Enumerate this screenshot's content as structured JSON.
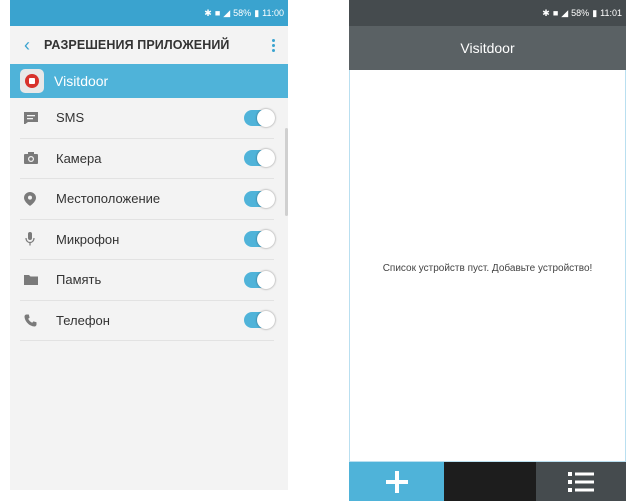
{
  "left_screen": {
    "status_bar": {
      "battery": "58%",
      "time": "11:00"
    },
    "header": {
      "back_icon": "chevron-left-icon",
      "title": "РАЗРЕШЕНИЯ ПРИЛОЖЕНИЙ",
      "menu_icon": "kebab-menu-icon"
    },
    "app": {
      "name": "Visitdoor",
      "icon": "visitdoor-logo"
    },
    "permissions": [
      {
        "label": "SMS",
        "icon": "message-icon",
        "enabled": true
      },
      {
        "label": "Камера",
        "icon": "camera-icon",
        "enabled": true
      },
      {
        "label": "Местоположение",
        "icon": "location-pin-icon",
        "enabled": true
      },
      {
        "label": "Микрофон",
        "icon": "microphone-icon",
        "enabled": true
      },
      {
        "label": "Память",
        "icon": "folder-icon",
        "enabled": true
      },
      {
        "label": "Телефон",
        "icon": "phone-icon",
        "enabled": true
      }
    ],
    "colors": {
      "accent": "#3aa3cf",
      "toggle_on": "#4fb3d9"
    }
  },
  "right_screen": {
    "status_bar": {
      "battery": "58%",
      "time": "11:01"
    },
    "title": "Visitdoor",
    "empty_message": "Список устройств пуст. Добавьте устройство!",
    "bottom_bar": {
      "add_icon": "plus-icon",
      "list_icon": "list-icon"
    },
    "colors": {
      "toolbar": "#5a6164",
      "add_button": "#4fb3d9"
    }
  }
}
